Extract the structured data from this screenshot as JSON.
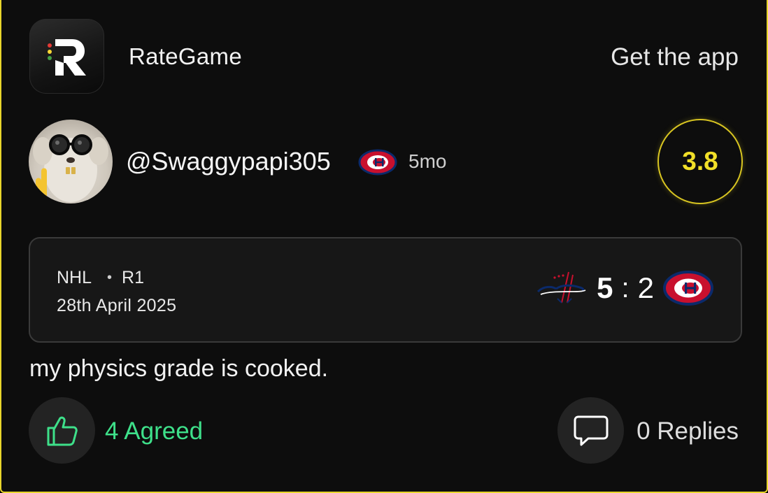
{
  "header": {
    "brand_name": "RateGame",
    "get_app_label": "Get the app"
  },
  "review": {
    "username": "@Swaggypapi305",
    "team_icon": "canadiens-logo",
    "time_ago": "5mo",
    "rating": "3.8",
    "comment": "my physics grade is cooked."
  },
  "game": {
    "league": "NHL",
    "separator": "•",
    "round": "R1",
    "date": "28th April 2025",
    "home_team_icon": "capitals-logo",
    "home_score": "5",
    "score_separator": ":",
    "away_score": "2",
    "away_team_icon": "canadiens-logo"
  },
  "actions": {
    "agree_icon": "thumbs-up-icon",
    "agree_label": "4 Agreed",
    "reply_icon": "speech-bubble-icon",
    "reply_label": "0 Replies"
  },
  "colors": {
    "accent_yellow": "#f1df28",
    "agree_green": "#3ee08a",
    "background": "#0d0d0d",
    "card_border": "#3a3a3a"
  }
}
